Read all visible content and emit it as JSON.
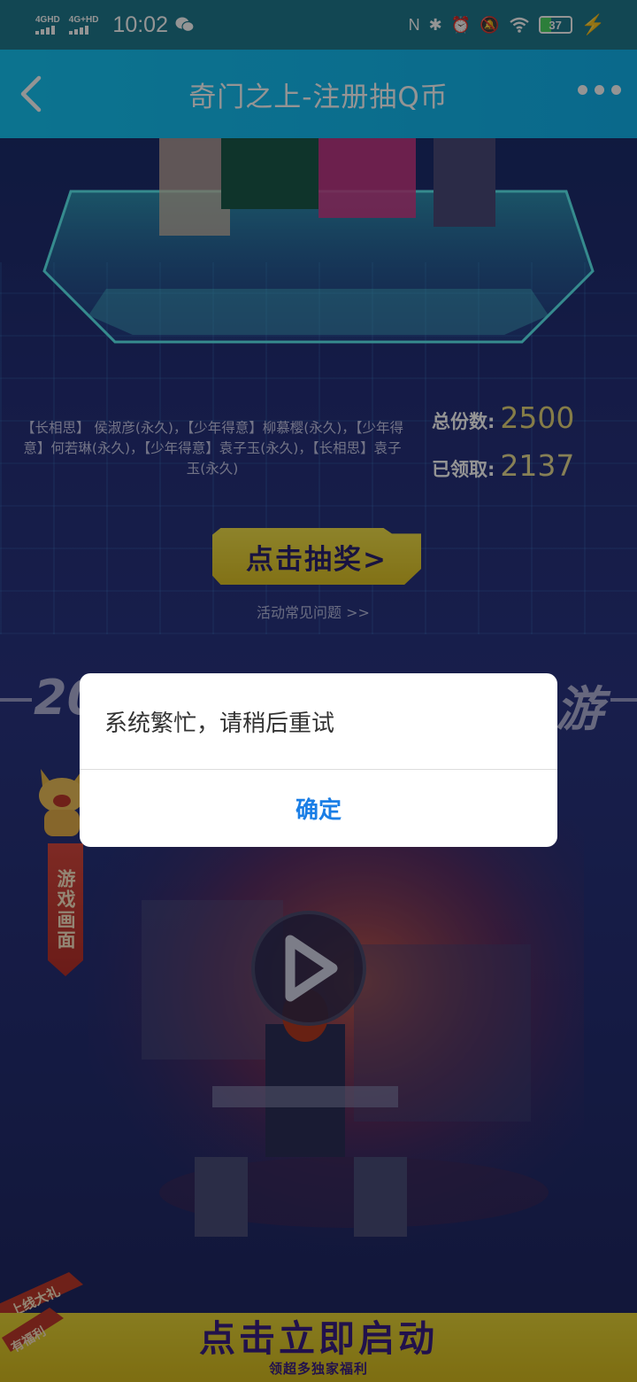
{
  "status_bar": {
    "signal1_label": "4GHD",
    "signal2_label": "4G+HD",
    "time": "10:02",
    "battery_level": "37",
    "icons": [
      "wechat-icon",
      "nfc-icon",
      "bluetooth-icon",
      "alarm-icon",
      "mute-icon",
      "wifi-icon",
      "battery-icon",
      "charging-icon"
    ]
  },
  "nav": {
    "title": "奇门之上-注册抽Q币"
  },
  "prize": {
    "text": "【长相思】 侯淑彦(永久)，【少年得意】柳慕樱(永久)，【少年得意】何若琳(永久)，【少年得意】袁子玉(永久)，【长相思】袁子玉(永久)",
    "total_label": "总份数:",
    "total_value": "2500",
    "claimed_label": "已领取:",
    "claimed_value": "2137"
  },
  "draw_button": {
    "label": "点击抽奖>"
  },
  "faq_link": "活动常见问题  >>",
  "banner": {
    "left": "20",
    "right": "游"
  },
  "side_tag": "游戏画面",
  "bottom_bar": {
    "main": "点击立即启动",
    "sub": "领超多独家福利",
    "ribbon_top": "上线大礼",
    "ribbon_bottom": "有福利"
  },
  "dialog": {
    "message": "系统繁忙，请稍后重试",
    "ok_label": "确定"
  },
  "colors": {
    "nav_bg": "#16c7f7",
    "status_bg": "#1f7a8f",
    "accent_yellow": "#e9d637",
    "dialog_button": "#1a7ee6"
  }
}
